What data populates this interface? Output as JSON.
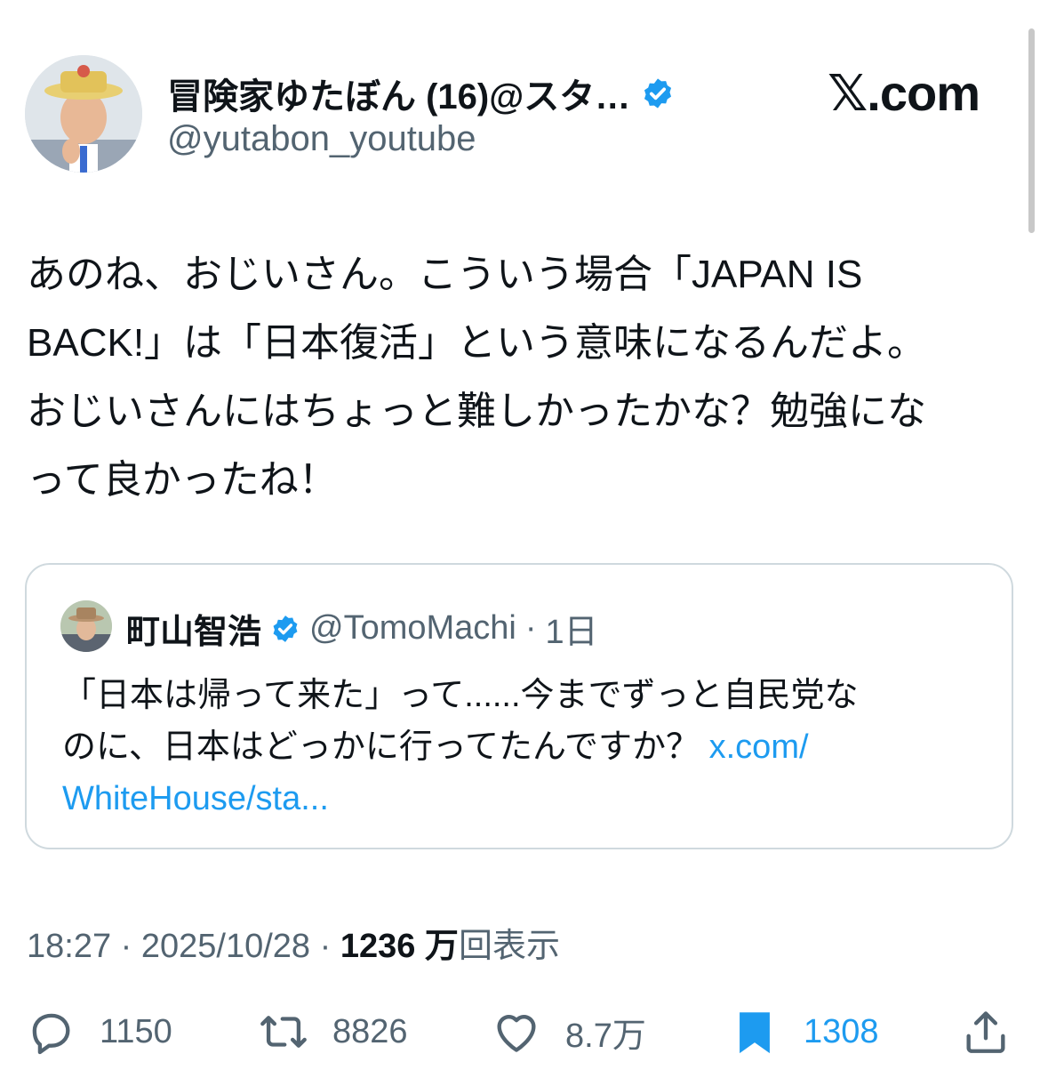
{
  "author": {
    "name": "冒険家ゆたぼん (16)@スタ…",
    "handle": "@yutabon_youtube",
    "verified": true
  },
  "site_logo": "𝕏.com",
  "tweet_text": "あのね、おじいさん。こういう場合「JAPAN IS\nBACK!」は「日本復活」という意味になるんだよ。\nおじいさんにはちょっと難しかったかな？勉強にな\nって良かったね！",
  "quoted": {
    "name": "町山智浩",
    "handle": "@TomoMachi",
    "separator": "·",
    "time": "1日",
    "text": "「日本は帰って来た」って......今までずっと自民党な\nのに、日本はどっかに行ってたんですか？ ",
    "link": "x.com/\nWhiteHouse/sta..."
  },
  "meta": {
    "time": "18:27",
    "sep1": "·",
    "date": "2025/10/28",
    "sep2": "·",
    "views_count": "1236 万",
    "views_label": "回表示"
  },
  "actions": {
    "replies": "1150",
    "reposts": "8826",
    "likes": "8.7万",
    "bookmarks": "1308"
  },
  "colors": {
    "text": "#0f1419",
    "secondary": "#536471",
    "accent": "#1d9bf0",
    "border": "#cfd9de",
    "verified": "#1d9bf0"
  },
  "icons": [
    "verified-badge-icon",
    "reply-icon",
    "repost-icon",
    "like-icon",
    "bookmark-icon",
    "share-icon"
  ]
}
